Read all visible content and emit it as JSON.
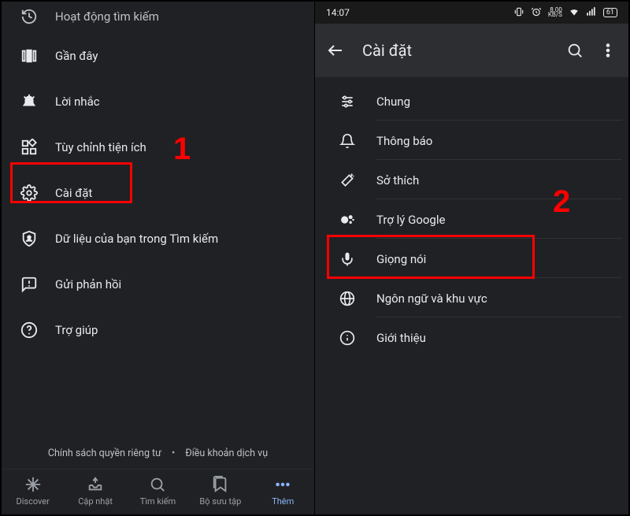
{
  "left": {
    "menu": [
      {
        "id": "search-activity",
        "label": "Hoạt động tìm kiếm",
        "truncated": true
      },
      {
        "id": "recent",
        "label": "Gần đây"
      },
      {
        "id": "reminders",
        "label": "Lời nhắc"
      },
      {
        "id": "widget",
        "label": "Tùy chỉnh tiện ích"
      },
      {
        "id": "settings",
        "label": "Cài đặt"
      },
      {
        "id": "your-data",
        "label": "Dữ liệu của bạn trong Tìm kiếm"
      },
      {
        "id": "feedback",
        "label": "Gửi phản hồi"
      },
      {
        "id": "help",
        "label": "Trợ giúp"
      }
    ],
    "footer": {
      "privacy": "Chính sách quyền riêng tư",
      "terms": "Điều khoản dịch vụ"
    },
    "tabs": [
      {
        "id": "discover",
        "label": "Discover"
      },
      {
        "id": "updates",
        "label": "Cập nhật"
      },
      {
        "id": "search",
        "label": "Tìm kiếm"
      },
      {
        "id": "collections",
        "label": "Bộ sưu tập"
      },
      {
        "id": "more",
        "label": "Thêm",
        "active": true
      }
    ]
  },
  "right": {
    "status": {
      "time": "14:07",
      "speed_top": "8.00",
      "speed_bot": "KB/S",
      "battery": "61"
    },
    "title": "Cài đặt",
    "items": [
      {
        "id": "general",
        "label": "Chung"
      },
      {
        "id": "notifications",
        "label": "Thông báo"
      },
      {
        "id": "interests",
        "label": "Sở thích"
      },
      {
        "id": "assistant",
        "label": "Trợ lý Google"
      },
      {
        "id": "voice",
        "label": "Giọng nói"
      },
      {
        "id": "language",
        "label": "Ngôn ngữ và khu vực"
      },
      {
        "id": "about",
        "label": "Giới thiệu"
      }
    ]
  },
  "annotations": {
    "num1": "1",
    "num2": "2"
  }
}
